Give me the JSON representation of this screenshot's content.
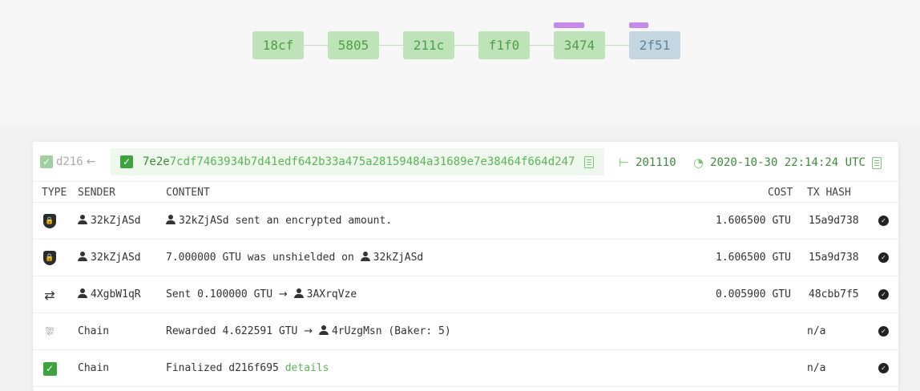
{
  "chain": {
    "blocks": [
      "18cf",
      "5805",
      "211c",
      "f1f0",
      "3474",
      "2f51"
    ]
  },
  "block": {
    "prev_hash": "d216",
    "hash_strong": "7e2e",
    "hash_rest": "7cdf7463934b7d41edf642b33a475a28159484a31689e7e38464f664d247",
    "height": "201110",
    "timestamp": "2020-10-30 22:14:24 UTC"
  },
  "columns": {
    "type": "TYPE",
    "sender": "SENDER",
    "content": "CONTENT",
    "cost": "COST",
    "tx_hash": "TX HASH"
  },
  "rows": [
    {
      "sender": "32kZjASd",
      "content_user": "32kZjASd",
      "content_text": "sent an encrypted amount.",
      "cost": "1.606500 GTU",
      "tx": "15a9d738"
    },
    {
      "sender": "32kZjASd",
      "content_text": "7.000000 GTU was unshielded on",
      "content_user": "32kZjASd",
      "cost": "1.606500 GTU",
      "tx": "15a9d738"
    },
    {
      "sender": "4XgbW1qR",
      "content_text": "Sent 0.100000 GTU",
      "arrow": "→",
      "content_user": "3AXrqVze",
      "cost": "0.005900 GTU",
      "tx": "48cbb7f5"
    },
    {
      "sender": "Chain",
      "content_text": "Rewarded 4.622591 GTU",
      "arrow": "→",
      "content_user": "4rUzgMsn",
      "content_suffix": "(Baker: 5)",
      "tx": "n/a"
    },
    {
      "sender": "Chain",
      "content_text": "Finalized d216f695",
      "link": "details",
      "tx": "n/a"
    }
  ]
}
